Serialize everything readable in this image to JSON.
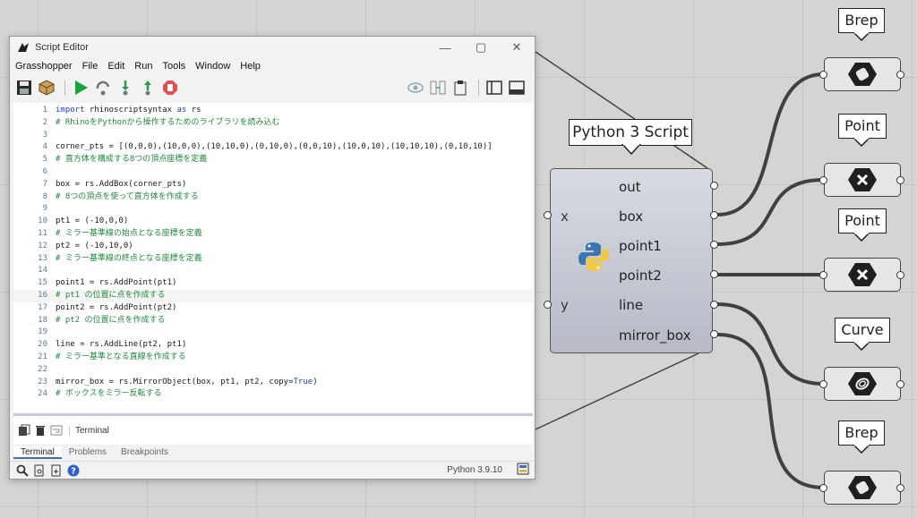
{
  "editor": {
    "title": "Script Editor",
    "menu": [
      "Grasshopper",
      "File",
      "Edit",
      "Run",
      "Tools",
      "Window",
      "Help"
    ],
    "code": [
      {
        "n": "1",
        "text": "import rhinoscriptsyntax as rs",
        "type": "code"
      },
      {
        "n": "2",
        "text": "# RhinoをPythonから操作するためのライブラリを読み込む",
        "type": "comment"
      },
      {
        "n": "3",
        "text": "",
        "type": "code"
      },
      {
        "n": "4",
        "text": "corner_pts = [(0,0,0),(10,0,0),(10,10,0),(0,10,0),(0,0,10),(10,0,10),(10,10,10),(0,10,10)]",
        "type": "code"
      },
      {
        "n": "5",
        "text": "# 直方体を構成する8つの頂点座標を定義",
        "type": "comment"
      },
      {
        "n": "6",
        "text": "",
        "type": "code"
      },
      {
        "n": "7",
        "text": "box = rs.AddBox(corner_pts)",
        "type": "code"
      },
      {
        "n": "8",
        "text": "# 8つの頂点を使って直方体を作成する",
        "type": "comment"
      },
      {
        "n": "9",
        "text": "",
        "type": "code"
      },
      {
        "n": "10",
        "text": "pt1 = (-10,0,0)",
        "type": "code"
      },
      {
        "n": "11",
        "text": "# ミラー基準線の始点となる座標を定義",
        "type": "comment"
      },
      {
        "n": "12",
        "text": "pt2 = (-10,10,0)",
        "type": "code"
      },
      {
        "n": "13",
        "text": "# ミラー基準線の終点となる座標を定義",
        "type": "comment"
      },
      {
        "n": "14",
        "text": "",
        "type": "code"
      },
      {
        "n": "15",
        "text": "point1 = rs.AddPoint(pt1)",
        "type": "code"
      },
      {
        "n": "16",
        "text": "# pt1 の位置に点を作成する",
        "type": "comment"
      },
      {
        "n": "17",
        "text": "point2 = rs.AddPoint(pt2)",
        "type": "code"
      },
      {
        "n": "18",
        "text": "# pt2 の位置に点を作成する",
        "type": "comment"
      },
      {
        "n": "19",
        "text": "",
        "type": "code"
      },
      {
        "n": "20",
        "text": "line = rs.AddLine(pt2, pt1)",
        "type": "code"
      },
      {
        "n": "21",
        "text": "# ミラー基準となる直線を作成する",
        "type": "comment"
      },
      {
        "n": "22",
        "text": "",
        "type": "code"
      },
      {
        "n": "23",
        "text": "mirror_box = rs.MirrorObject(box, pt1, pt2, copy=True)",
        "type": "code"
      },
      {
        "n": "24",
        "text": "# ボックスをミラー反転する",
        "type": "comment"
      }
    ],
    "active_line": "16",
    "terminal_label": "Terminal",
    "tabs": [
      "Terminal",
      "Problems",
      "Breakpoints"
    ],
    "selected_tab": "Terminal",
    "python_version": "Python 3.9.10"
  },
  "component": {
    "title": "Python 3 Script",
    "inputs": [
      "x",
      "y"
    ],
    "outputs": [
      "out",
      "box",
      "point1",
      "point2",
      "line",
      "mirror_box"
    ]
  },
  "params": [
    {
      "title": "Brep",
      "icon": "brep-icon"
    },
    {
      "title": "Point",
      "icon": "point-icon"
    },
    {
      "title": "Point",
      "icon": "point-icon"
    },
    {
      "title": "Curve",
      "icon": "curve-icon"
    },
    {
      "title": "Brep",
      "icon": "brep-icon"
    }
  ],
  "colors": {
    "comment": "#1e8a3a",
    "keyword": "#1a3ec8",
    "canvas": "#d4d4d2",
    "wire": "#404040"
  }
}
